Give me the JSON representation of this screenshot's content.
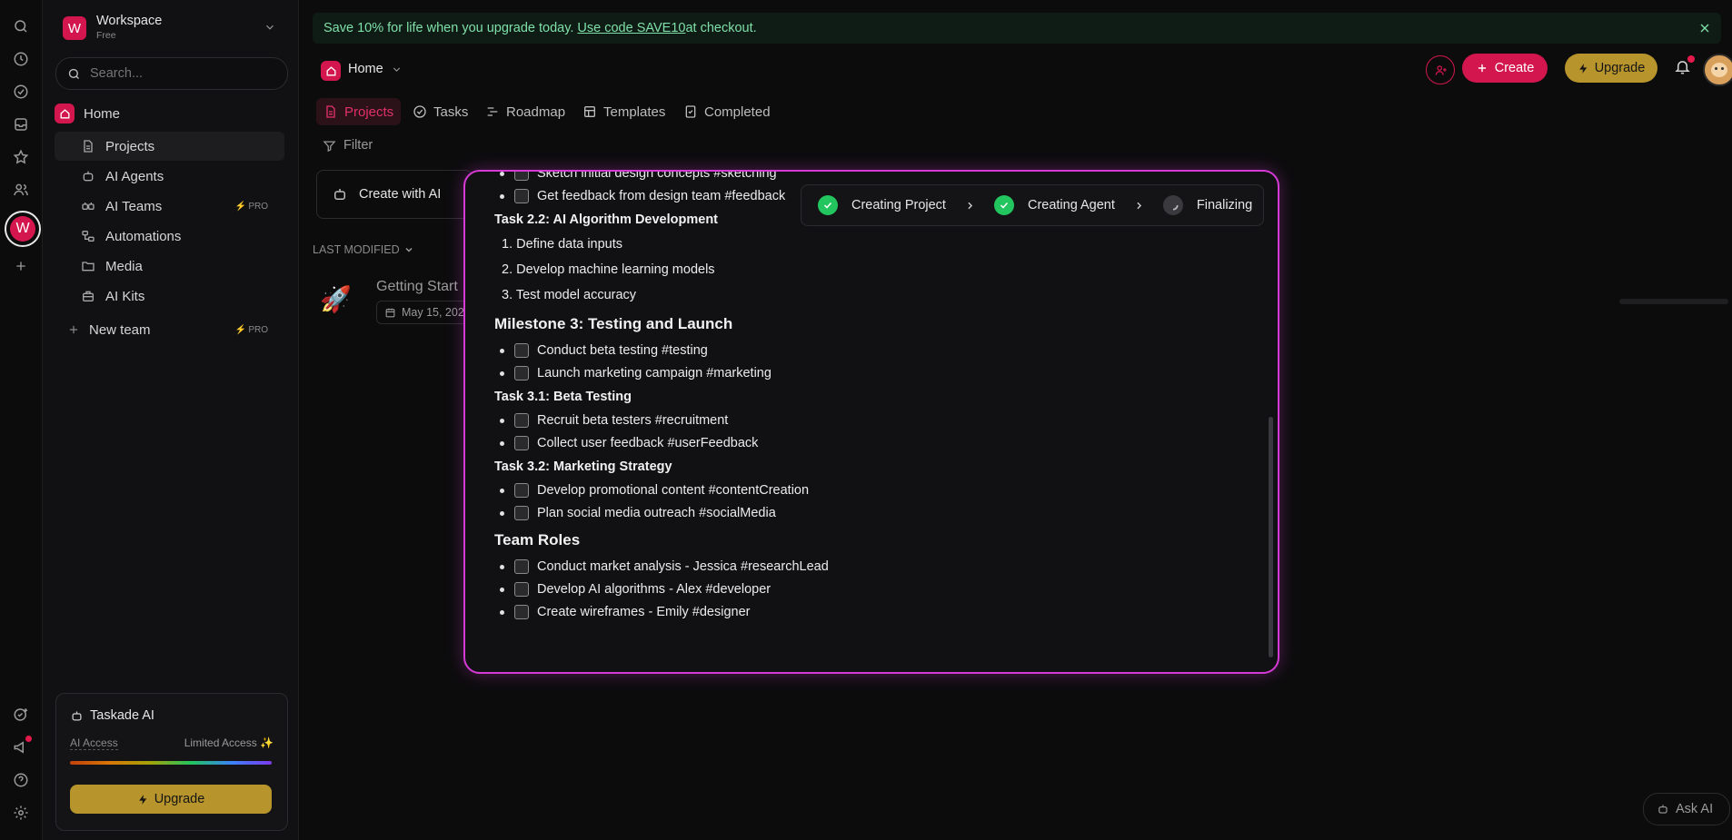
{
  "workspace": {
    "initial": "W",
    "name": "Workspace",
    "plan": "Free"
  },
  "search": {
    "placeholder": "Search..."
  },
  "sidebar": {
    "home": "Home",
    "items": [
      {
        "label": "Projects",
        "icon": "document-icon"
      },
      {
        "label": "AI Agents",
        "icon": "robot-icon"
      },
      {
        "label": "AI Teams",
        "icon": "team-icon",
        "badge": "PRO"
      },
      {
        "label": "Automations",
        "icon": "automation-icon"
      },
      {
        "label": "Media",
        "icon": "folder-icon"
      },
      {
        "label": "AI Kits",
        "icon": "kit-icon"
      }
    ],
    "new_team": "New team",
    "new_team_badge": "PRO"
  },
  "ai_card": {
    "title": "Taskade AI",
    "access_label": "AI Access",
    "access_value": "Limited Access ✨",
    "upgrade": "Upgrade"
  },
  "banner": {
    "text": "Save 10% for life when you upgrade today. ",
    "code": "Use code SAVE10",
    "suffix": " at checkout."
  },
  "header": {
    "breadcrumb": "Home",
    "create": "Create",
    "upgrade": "Upgrade"
  },
  "tabs": [
    "Projects",
    "Tasks",
    "Roadmap",
    "Templates",
    "Completed"
  ],
  "filter": "Filter",
  "create_ai": "Create with AI",
  "last_modified": "LAST MODIFIED",
  "project": {
    "title": "Getting Start",
    "date": "May 15, 202"
  },
  "progress": {
    "steps": [
      {
        "label": "Creating Project",
        "state": "done"
      },
      {
        "label": "Creating Agent",
        "state": "done"
      },
      {
        "label": "Finalizing",
        "state": "loading"
      }
    ]
  },
  "doc": {
    "top_clipped": "Sketch initial design concepts #sketching",
    "item_feedback": "Get feedback from design team #feedback",
    "task22": "Task 2.2: AI Algorithm Development",
    "ol": [
      "1. Define data inputs",
      "2. Develop machine learning models",
      "3. Test model accuracy"
    ],
    "m3": "Milestone 3: Testing and Launch",
    "m3_items": [
      "Conduct beta testing #testing",
      "Launch marketing campaign #marketing"
    ],
    "task31": "Task 3.1: Beta Testing",
    "t31_items": [
      "Recruit beta testers #recruitment",
      "Collect user feedback #userFeedback"
    ],
    "task32": "Task 3.2: Marketing Strategy",
    "t32_items": [
      "Develop promotional content #contentCreation",
      "Plan social media outreach #socialMedia"
    ],
    "roles": "Team Roles",
    "roles_items": [
      "Conduct market analysis - Jessica #researchLead",
      "Develop AI algorithms - Alex #developer",
      "Create wireframes - Emily #designer"
    ]
  },
  "ask_ai": "Ask AI",
  "colors": {
    "accent": "#d4164e",
    "gold": "#b7952c",
    "success": "#22c55e",
    "modal_border": "#d63ad6"
  }
}
